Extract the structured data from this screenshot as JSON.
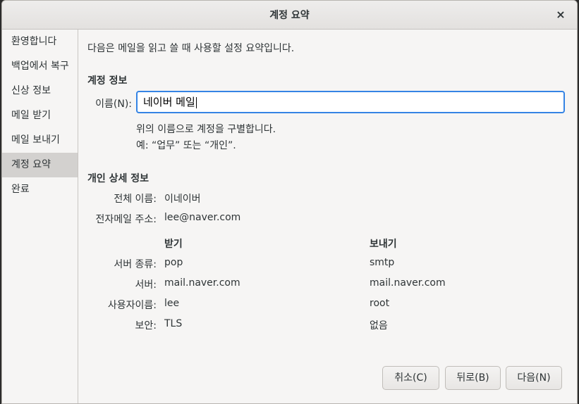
{
  "window": {
    "title": "계정 요약",
    "close_icon": "×"
  },
  "sidebar": {
    "items": [
      {
        "label": "환영합니다"
      },
      {
        "label": "백업에서 복구"
      },
      {
        "label": "신상 정보"
      },
      {
        "label": "메일 받기"
      },
      {
        "label": "메일 보내기"
      },
      {
        "label": "계정 요약"
      },
      {
        "label": "완료"
      }
    ],
    "active_index": 5
  },
  "main": {
    "intro": "다음은 메일을 읽고 쓸 때 사용할 설정 요약입니다.",
    "account_section": {
      "title": "계정 정보",
      "name_label": "이름(N):",
      "name_value": "네이버 메일",
      "hint_line1": "위의 이름으로 계정을 구별합니다.",
      "hint_line2": "예: “업무” 또는 “개인”."
    },
    "personal_section": {
      "title": "개인 상세 정보",
      "full_name_label": "전체 이름:",
      "full_name_value": "이네이버",
      "email_label": "전자메일 주소:",
      "email_value": "lee@naver.com"
    },
    "servers": {
      "receive_header": "받기",
      "send_header": "보내기",
      "rows": [
        {
          "label": "서버 종류:",
          "receive": "pop",
          "send": "smtp"
        },
        {
          "label": "서버:",
          "receive": "mail.naver.com",
          "send": "mail.naver.com"
        },
        {
          "label": "사용자이름:",
          "receive": "lee",
          "send": "root"
        },
        {
          "label": "보안:",
          "receive": "TLS",
          "send": "없음"
        }
      ]
    }
  },
  "buttons": {
    "cancel": "취소(C)",
    "back": "뒤로(B)",
    "next": "다음(N)"
  }
}
